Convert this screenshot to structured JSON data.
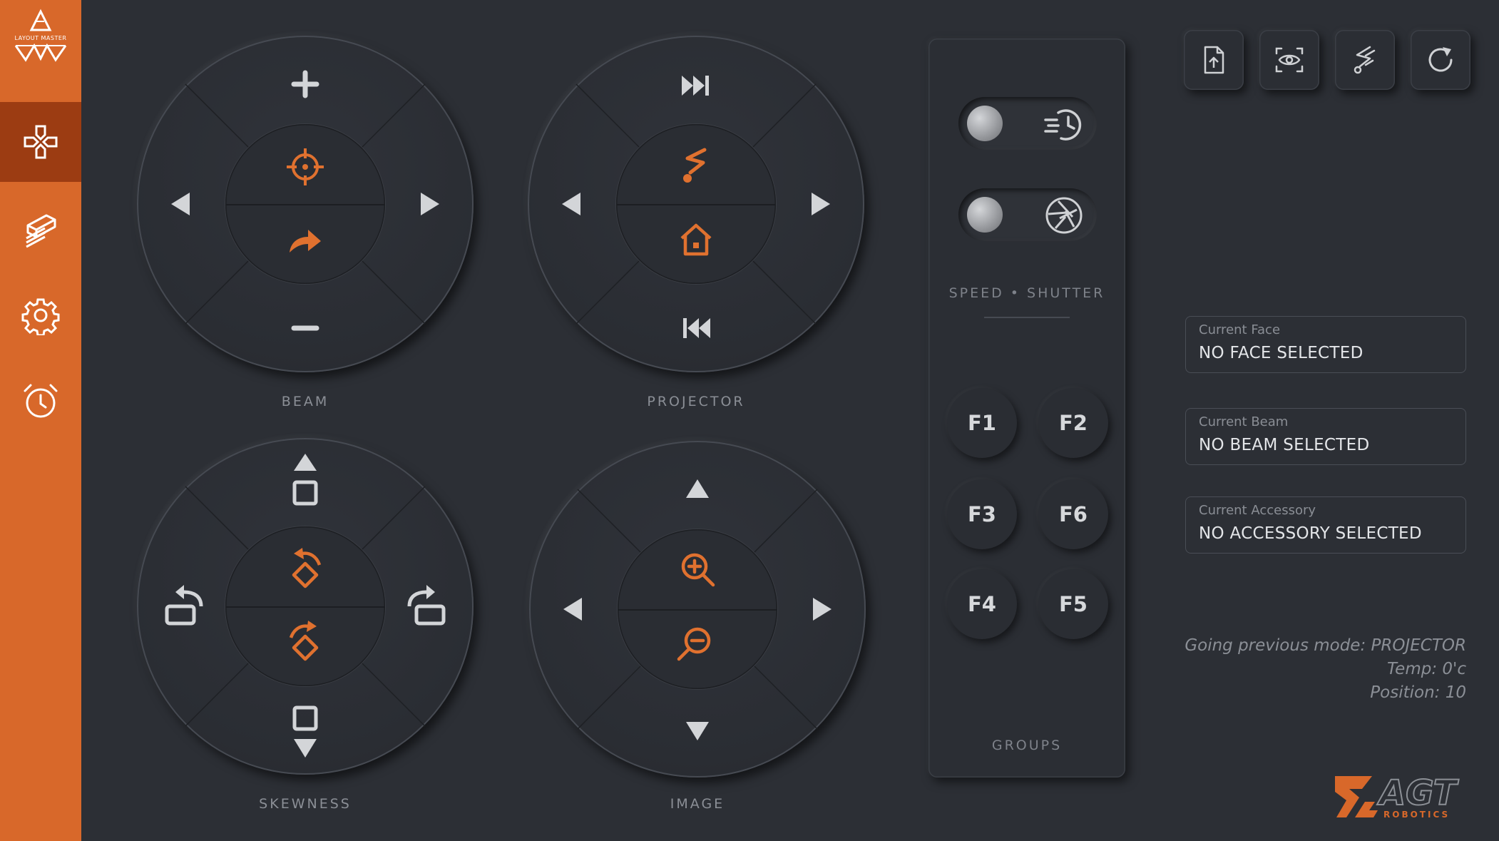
{
  "sidebar": {
    "logo_text": "LAYOUT MASTER",
    "items": [
      {
        "name": "gamepad-icon",
        "active": true
      },
      {
        "name": "laser-level-icon",
        "active": false
      },
      {
        "name": "gear-icon",
        "active": false
      },
      {
        "name": "alarm-clock-icon",
        "active": false
      }
    ]
  },
  "dials": {
    "beam": {
      "label": "BEAM"
    },
    "projector": {
      "label": "PROJECTOR"
    },
    "skewness": {
      "label": "SKEWNESS"
    },
    "image": {
      "label": "IMAGE"
    }
  },
  "panel": {
    "toggles": [
      {
        "icon": "speed-clock-icon"
      },
      {
        "icon": "shutter-aperture-icon"
      }
    ],
    "section_label": "SPEED • SHUTTER",
    "groups_label": "GROUPS",
    "buttons": [
      "F1",
      "F2",
      "F3",
      "F6",
      "F4",
      "F5"
    ]
  },
  "toolbar": {
    "icons": [
      "file-upload-icon",
      "eye-scan-icon",
      "laser-icon",
      "refresh-icon"
    ]
  },
  "info": {
    "face": {
      "label": "Current Face",
      "value": "NO FACE SELECTED"
    },
    "beam": {
      "label": "Current Beam",
      "value": "NO BEAM SELECTED"
    },
    "accessory": {
      "label": "Current Accessory",
      "value": "NO ACCESSORY SELECTED"
    }
  },
  "status": {
    "mode": "Going previous mode: PROJECTOR",
    "temp": "Temp: 0'c",
    "position": "Position: 10"
  },
  "brand": {
    "name": "AGT",
    "sub": "ROBOTICS",
    "accent": "#e0712f",
    "sidebar": "#d8682a",
    "sidebar_active": "#9c3c12"
  }
}
